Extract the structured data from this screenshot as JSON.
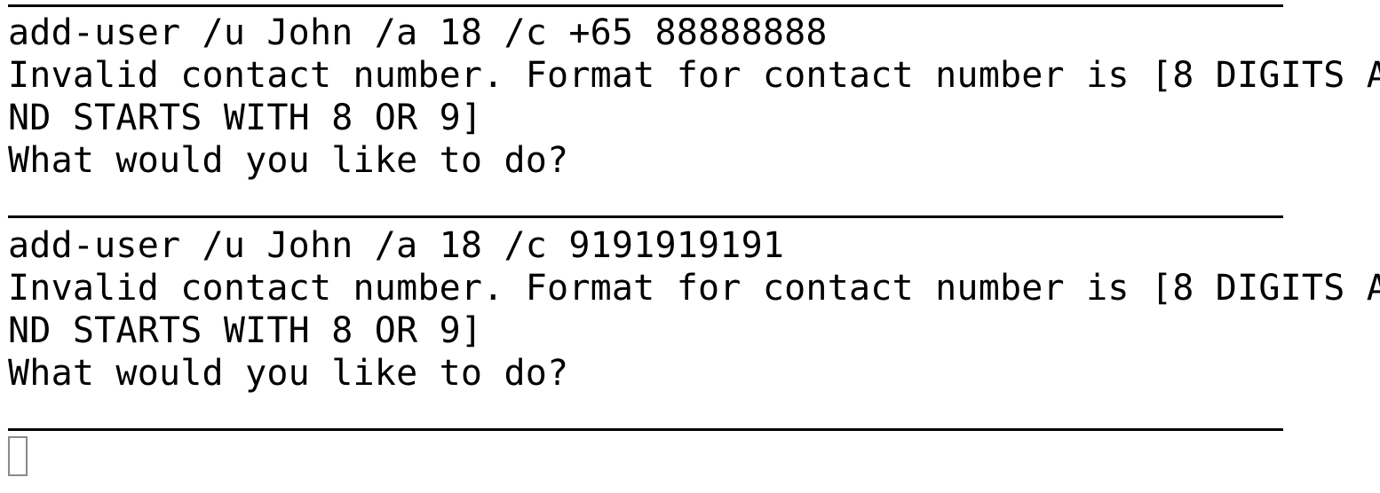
{
  "terminal": {
    "blocks": [
      {
        "command": "add-user /u John /a 18 /c +65 88888888",
        "error_line_1": "Invalid contact number. Format for contact number is [8 DIGITS A",
        "error_line_2": "ND STARTS WITH 8 OR 9]",
        "prompt": "What would you like to do?"
      },
      {
        "command": "add-user /u John /a 18 /c 9191919191",
        "error_line_1": "Invalid contact number. Format for contact number is [8 DIGITS A",
        "error_line_2": "ND STARTS WITH 8 OR 9]",
        "prompt": "What would you like to do?"
      }
    ]
  }
}
